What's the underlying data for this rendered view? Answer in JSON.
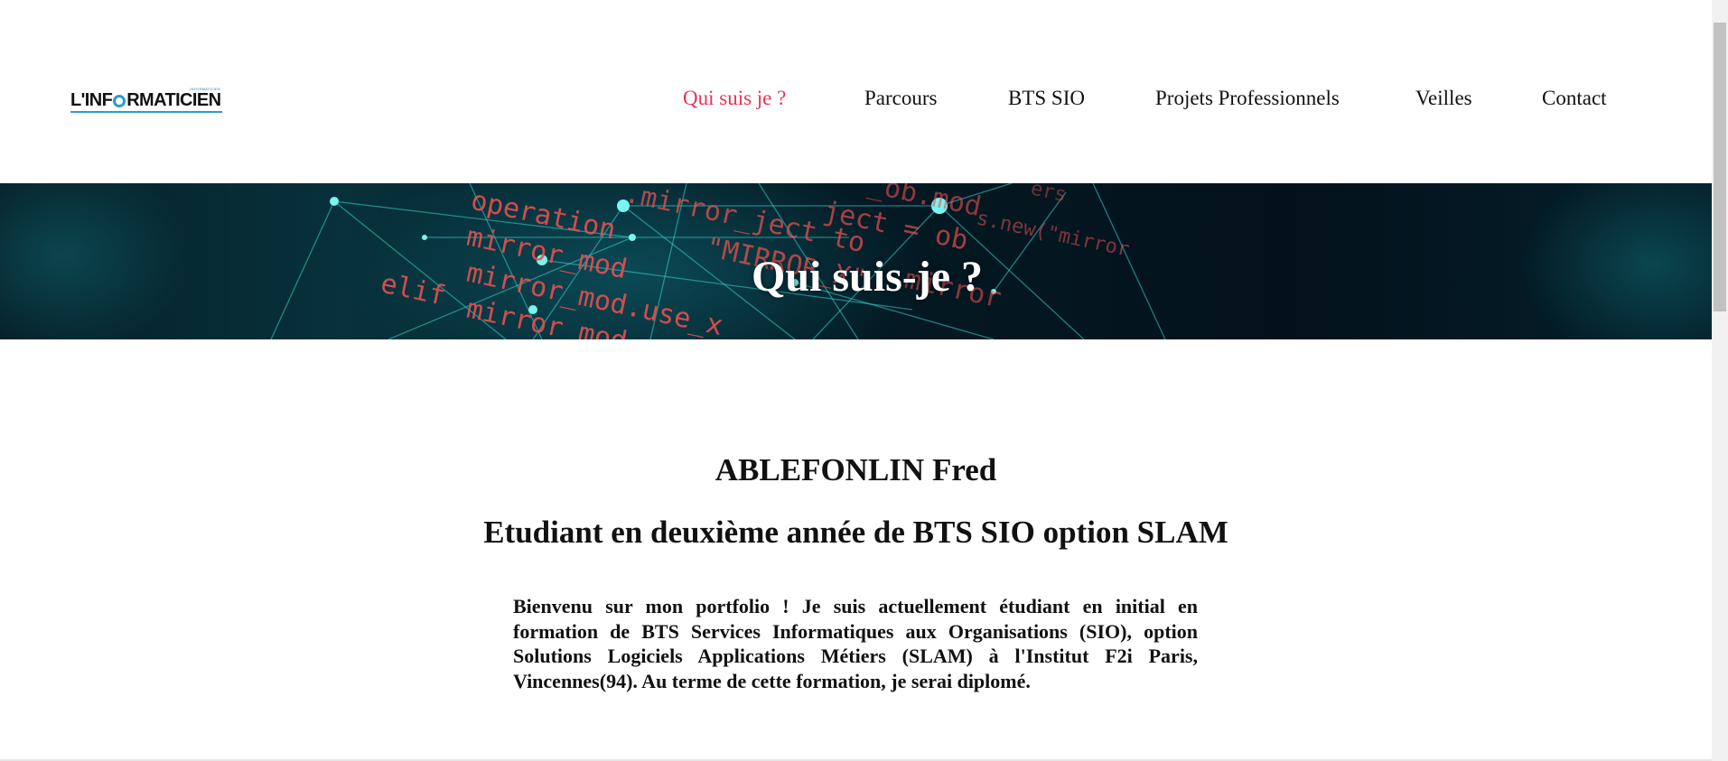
{
  "header": {
    "logo": {
      "prefix": "L'INF",
      "suffix": "RMATICIEN",
      "small_text": "INFORMATICIEN"
    },
    "nav": [
      {
        "label": "Qui suis je ?",
        "active": true
      },
      {
        "label": "Parcours",
        "active": false
      },
      {
        "label": "BTS SIO",
        "active": false
      },
      {
        "label": "Projets Professionnels",
        "active": false
      },
      {
        "label": "Veilles",
        "active": false
      },
      {
        "label": "Contact",
        "active": false
      }
    ]
  },
  "banner": {
    "title": "Qui suis-je ?",
    "code_lines": [
      "operation",
      "mirror_mod",
      "mirror_mod.use_x",
      "elif",
      "mirror_mod.use_x"
    ]
  },
  "main": {
    "name": "ABLEFONLIN Fred",
    "subtitle": "Etudiant en deuxième année de BTS SIO option SLAM",
    "intro": "Bienvenu sur mon portfolio ! Je suis actuellement étudiant en initial en formation de BTS Services Informatiques aux Organisations (SIO), option Solutions Logiciels Applications Métiers (SLAM) à l'Institut F2i Paris, Vincennes(94). Au terme de cette formation, je serai diplomé."
  },
  "colors": {
    "accent": "#e8325a",
    "text": "#111111",
    "logo_blue": "#2c9ad6",
    "banner_bg": "#041a24",
    "code_red": "#e8504f",
    "network_cyan": "#35d6d0"
  }
}
